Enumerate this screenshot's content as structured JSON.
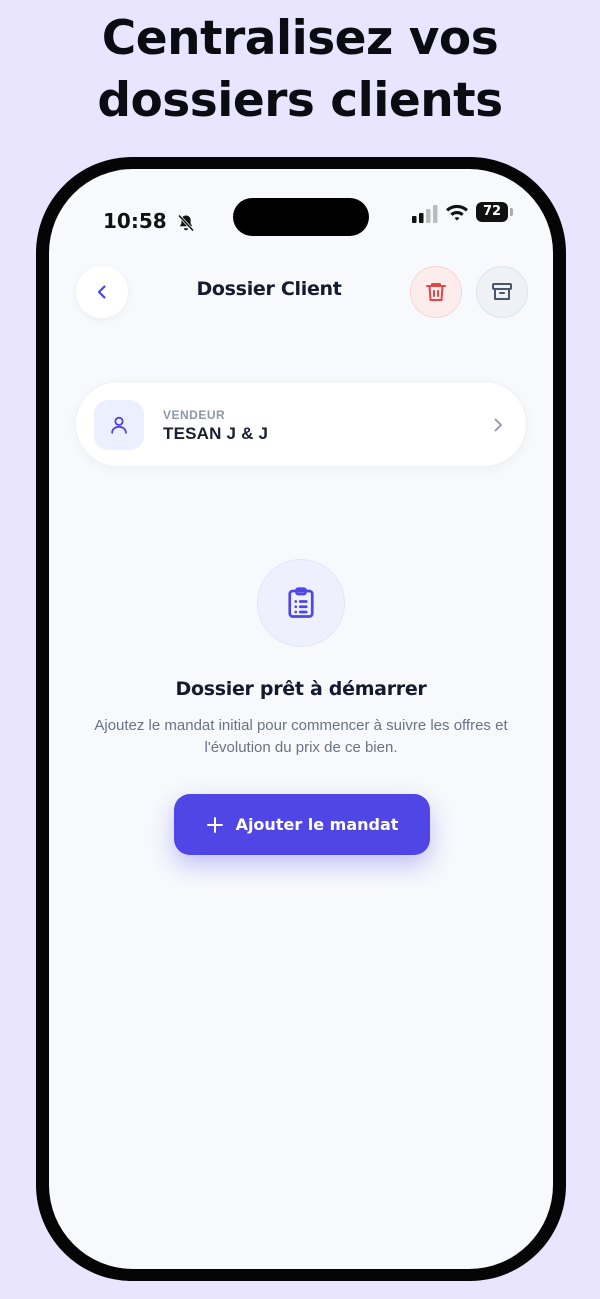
{
  "headline": {
    "line1": "Centralisez vos",
    "line2": "dossiers clients"
  },
  "status_bar": {
    "time": "10:58",
    "battery": "72"
  },
  "header": {
    "title": "Dossier Client"
  },
  "client": {
    "role": "VENDEUR",
    "name": "TESAN J & J"
  },
  "empty_state": {
    "title": "Dossier prêt à démarrer",
    "description": "Ajoutez le mandat initial pour commencer à suivre les offres et l'évolution du prix de ce bien.",
    "button_label": "Ajouter le mandat"
  },
  "colors": {
    "background": "#e9e4ff",
    "accent": "#4f46e5",
    "danger": "#e04848",
    "screen": "#f7f9fc"
  },
  "icons": [
    "bell-slash-icon",
    "signal-icon",
    "wifi-icon",
    "battery-icon",
    "chevron-left-icon",
    "trash-icon",
    "archive-icon",
    "user-icon",
    "chevron-right-icon",
    "clipboard-list-icon",
    "plus-icon"
  ]
}
